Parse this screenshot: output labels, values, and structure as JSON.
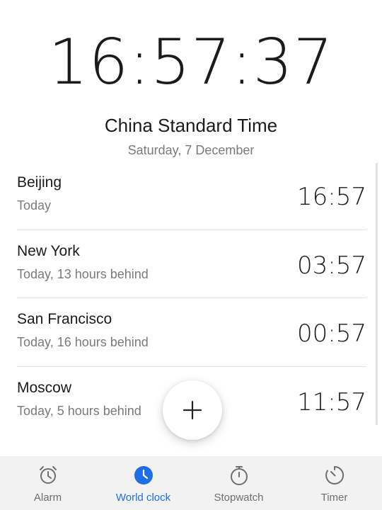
{
  "clock": {
    "main_time": "16:57:37",
    "timezone": "China Standard Time",
    "date": "Saturday, 7 December"
  },
  "cities": [
    {
      "name": "Beijing",
      "subtitle": "Today",
      "time": "16:57"
    },
    {
      "name": "New York",
      "subtitle": "Today, 13 hours behind",
      "time": "03:57"
    },
    {
      "name": "San Francisco",
      "subtitle": "Today, 16 hours behind",
      "time": "00:57"
    },
    {
      "name": "Moscow",
      "subtitle": "Today, 5 hours behind",
      "time": "11:57"
    }
  ],
  "fab": {
    "icon": "plus-icon"
  },
  "nav": {
    "items": [
      {
        "label": "Alarm",
        "icon": "alarm-icon",
        "active": false
      },
      {
        "label": "World clock",
        "icon": "world-clock-icon",
        "active": true
      },
      {
        "label": "Stopwatch",
        "icon": "stopwatch-icon",
        "active": false
      },
      {
        "label": "Timer",
        "icon": "timer-icon",
        "active": false
      }
    ]
  },
  "colors": {
    "accent": "#1e6fe6",
    "text_primary": "#1b1b1b",
    "text_secondary": "#7a7a7a",
    "nav_bg": "#f2f2f2",
    "inactive_icon": "#6e6e6e"
  }
}
